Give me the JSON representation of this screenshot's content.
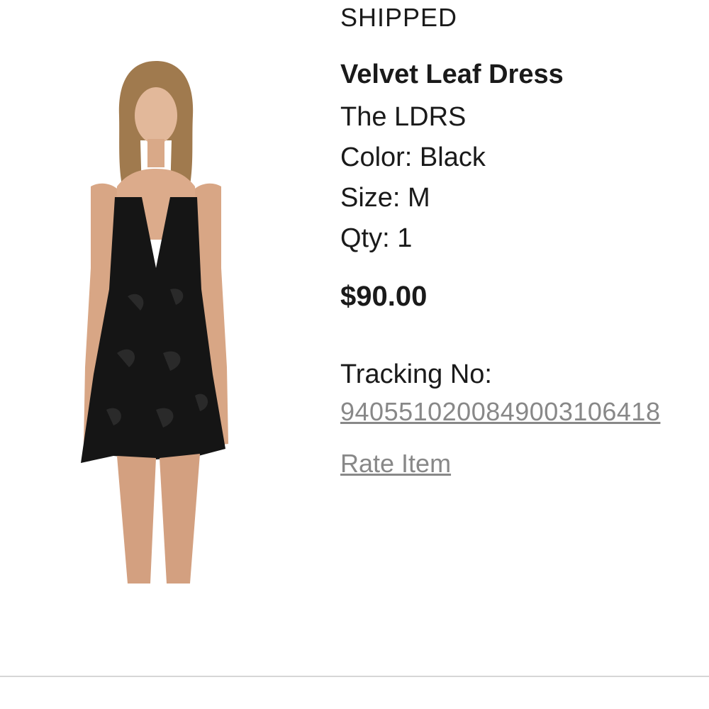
{
  "order_item": {
    "status": "SHIPPED",
    "name": "Velvet Leaf Dress",
    "brand": "The LDRS",
    "color": "Color: Black",
    "size": "Size: M",
    "qty": "Qty: 1",
    "price": "$90.00",
    "tracking_label": "Tracking No:",
    "tracking_number": "9405510200849003106418",
    "rate_item_label": "Rate Item"
  },
  "colors": {
    "text": "#1a1a1a",
    "link": "#888888",
    "divider": "#d6d6d6",
    "background": "#ffffff"
  }
}
